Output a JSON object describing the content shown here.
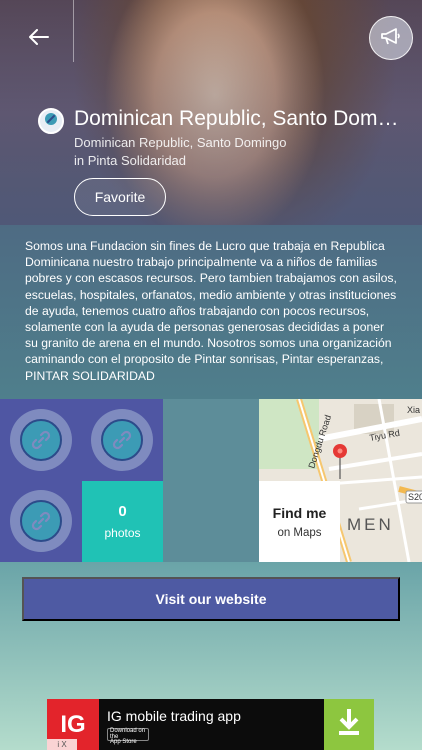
{
  "header": {
    "back_icon": "back-arrow-icon",
    "megaphone_icon": "megaphone-icon",
    "org_logo_icon": "link-icon"
  },
  "organization": {
    "title": "Dominican Republic, Santo Dom…",
    "location": "Dominican Republic, Santo Domingo",
    "parent": "in Pinta Solidaridad",
    "favorite_label": "Favorite",
    "description": "Somos una Fundacion sin fines de Lucro que trabaja en Republica Dominicana nuestro trabajo principalmente va a niños de familias pobres y con escasos recursos. Pero tambien trabajamos con asilos, escuelas, hospitales, orfanatos, medio ambiente y otras instituciones de ayuda, tenemos cuatro años trabajando con pocos recursos, solamente con la ayuda de personas generosas decididas a poner su granito de arena en el mundo. Nosotros somos una organización caminando con el proposito de Pintar sonrisas, Pintar esperanzas, PINTAR SOLIDARIDAD"
  },
  "tiles": {
    "photos_count": "0",
    "photos_label": "photos",
    "find_title": "Find me",
    "find_sub": "on Maps"
  },
  "map": {
    "road_label_1": "Dongdu Road",
    "road_label_2": "Tiyu Rd",
    "road_label_3": "Xia",
    "road_label_4": "S20",
    "area_label": "MEN"
  },
  "website_label": "Visit our website",
  "ad": {
    "logo_text": "IG",
    "title": "IG mobile trading app",
    "store_line_1": "Download on the",
    "store_line_2": "App Store",
    "info_text": "i X"
  },
  "colors": {
    "accent": "#4e5aa3",
    "teal": "#20c2b5",
    "ad_green": "#8dc63f",
    "ad_red": "#e3242b"
  }
}
